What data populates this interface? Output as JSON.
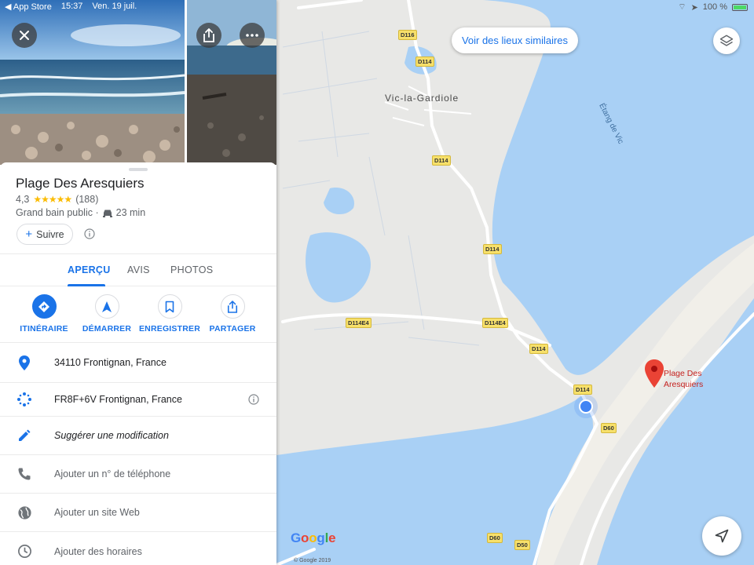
{
  "status_bar": {
    "back_app": "◀ App Store",
    "time": "15:37",
    "date": "Ven. 19 juil.",
    "battery": "100 %"
  },
  "map": {
    "town_label": "Vic-la-Gardiole",
    "water_label": "Étang de Vic",
    "roads": [
      "D116",
      "D114",
      "D114",
      "D114",
      "D114E4",
      "D114E4",
      "D114",
      "D114",
      "D60",
      "D60",
      "D50"
    ],
    "pin_label_line1": "Plage Des",
    "pin_label_line2": "Aresquiers",
    "google_logo": "Google",
    "copyright": "© Google 2019",
    "similar_button": "Voir des lieux similaires",
    "colors": {
      "water": "#a9d0f5",
      "land": "#e8e8e6",
      "pin": "#ea4335",
      "location": "#4285f4"
    }
  },
  "place": {
    "title": "Plage Des Aresquiers",
    "rating": "4,3",
    "stars": "★★★★★",
    "review_count": "(188)",
    "category": "Grand bain public ·",
    "travel_time": "23 min",
    "follow_label": "Suivre"
  },
  "tabs": [
    {
      "label": "APERÇU",
      "active": true
    },
    {
      "label": "AVIS",
      "active": false
    },
    {
      "label": "PHOTOS",
      "active": false
    }
  ],
  "actions": [
    {
      "label": "ITINÉRAIRE",
      "icon": "directions-icon"
    },
    {
      "label": "DÉMARRER",
      "icon": "navigation-icon"
    },
    {
      "label": "ENREGISTRER",
      "icon": "bookmark-icon"
    },
    {
      "label": "PARTAGER",
      "icon": "share-icon"
    }
  ],
  "details": [
    {
      "text": "34110 Frontignan, France",
      "icon": "location-pin-icon"
    },
    {
      "text": "FR8F+6V Frontignan, France",
      "icon": "plus-code-icon"
    },
    {
      "text": "Suggérer une modification",
      "icon": "edit-icon"
    },
    {
      "text": "Ajouter un n° de téléphone",
      "icon": "phone-icon"
    },
    {
      "text": "Ajouter un site Web",
      "icon": "globe-icon"
    },
    {
      "text": "Ajouter des horaires",
      "icon": "clock-icon"
    }
  ],
  "accent_color": "#1a73e8"
}
